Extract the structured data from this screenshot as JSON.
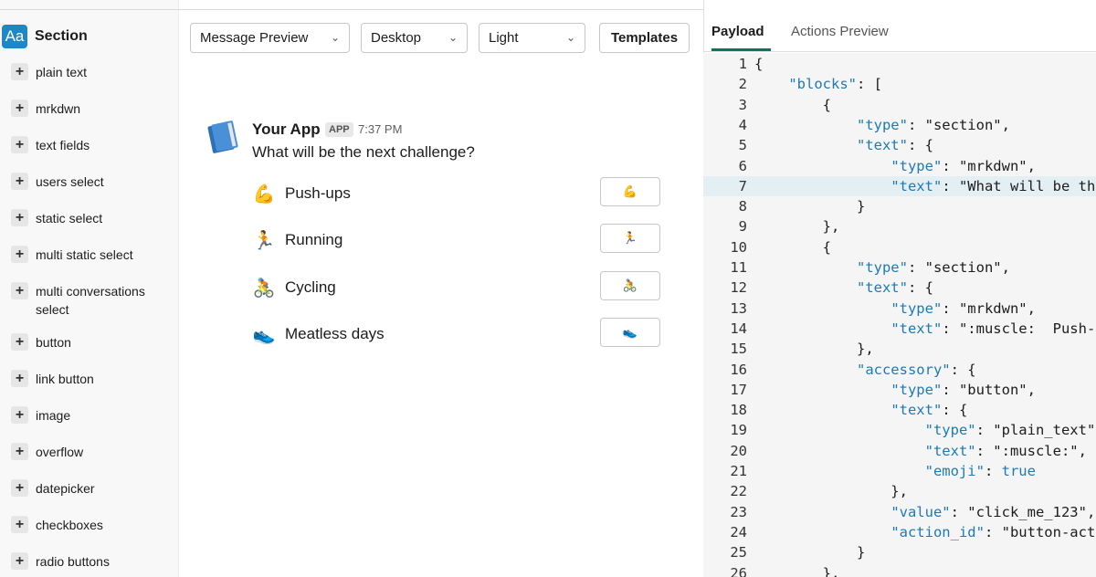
{
  "sidebar": {
    "section_icon": "Aa",
    "section_label": "Section",
    "items": [
      {
        "label": "plain text"
      },
      {
        "label": "mrkdwn"
      },
      {
        "label": "text fields"
      },
      {
        "label": "users select"
      },
      {
        "label": "static select"
      },
      {
        "label": "multi static select"
      },
      {
        "label": "multi conversations select"
      },
      {
        "label": "button"
      },
      {
        "label": "link button"
      },
      {
        "label": "image"
      },
      {
        "label": "overflow"
      },
      {
        "label": "datepicker"
      },
      {
        "label": "checkboxes"
      },
      {
        "label": "radio buttons"
      }
    ]
  },
  "toolbar": {
    "preview_mode": "Message Preview",
    "device": "Desktop",
    "theme": "Light",
    "templates_label": "Templates"
  },
  "message": {
    "app_name": "Your App",
    "badge": "APP",
    "time": "7:37 PM",
    "text": "What will be the next challenge?",
    "avatar_icon": "book-icon",
    "rows": [
      {
        "emoji": "💪",
        "label": "Push-ups",
        "button_emoji": "💪",
        "icon": "muscle-icon"
      },
      {
        "emoji": "🏃",
        "label": "Running",
        "button_emoji": "🏃",
        "icon": "runner-icon"
      },
      {
        "emoji": "🚴",
        "label": "Cycling",
        "button_emoji": "🚴",
        "icon": "bicyclist-icon"
      },
      {
        "emoji": "👟",
        "label": "Meatless days",
        "button_emoji": "👟",
        "icon": "shoe-icon"
      }
    ]
  },
  "right_pane": {
    "tabs": [
      "Payload",
      "Actions Preview"
    ],
    "active_tab": "Payload",
    "highlighted_line": 7,
    "code_lines": [
      "{",
      "    \"blocks\": [",
      "        {",
      "            \"type\": \"section\",",
      "            \"text\": {",
      "                \"type\": \"mrkdwn\",",
      "                \"text\": \"What will be the",
      "            }",
      "        },",
      "        {",
      "            \"type\": \"section\",",
      "            \"text\": {",
      "                \"type\": \"mrkdwn\",",
      "                \"text\": \":muscle:  Push-u",
      "            },",
      "            \"accessory\": {",
      "                \"type\": \"button\",",
      "                \"text\": {",
      "                    \"type\": \"plain_text\",",
      "                    \"text\": \":muscle:\",",
      "                    \"emoji\": true",
      "                },",
      "                \"value\": \"click_me_123\",",
      "                \"action_id\": \"button-acti",
      "            }",
      "        },"
    ]
  },
  "colors": {
    "accent": "#1e88c7",
    "tab_underline": "#007a5a",
    "json_key": "#1d7ab5",
    "highlight": "#e3eff3"
  }
}
